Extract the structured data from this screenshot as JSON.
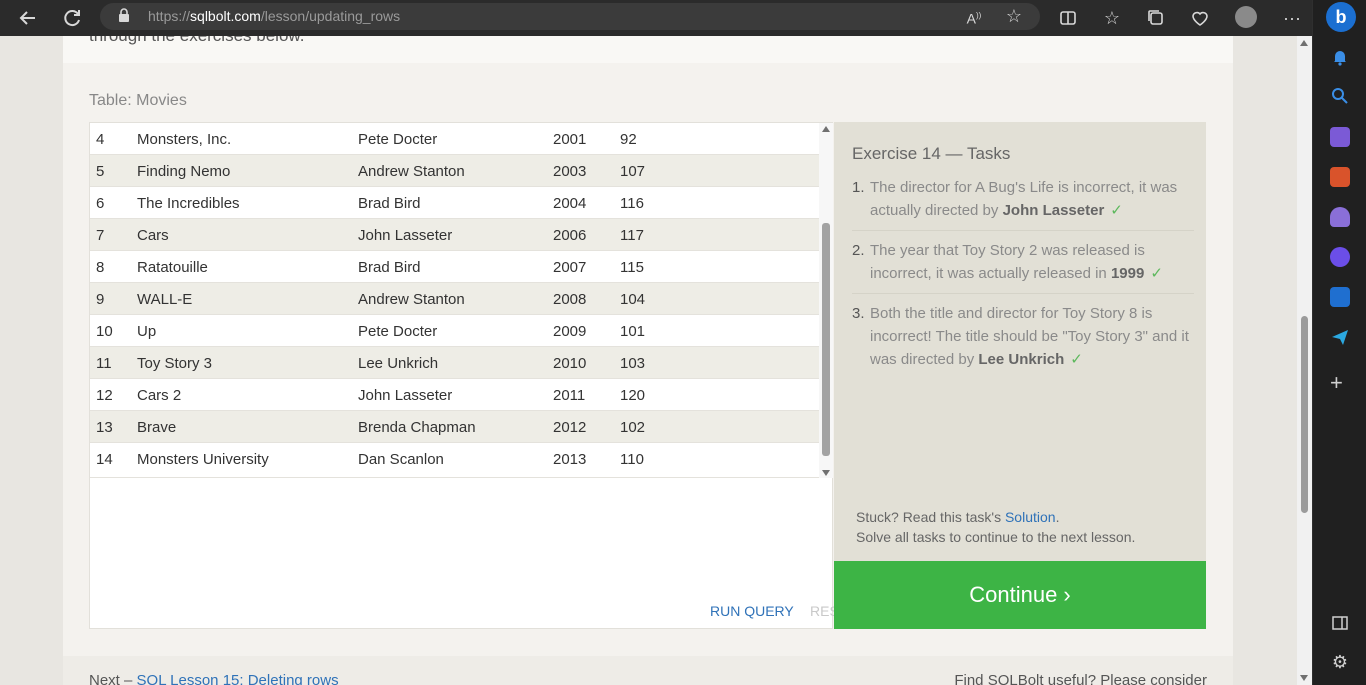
{
  "browser": {
    "url_prefix": "https://",
    "url_domain": "sqlbolt.com",
    "url_path": "/lesson/updating_rows"
  },
  "icons": {
    "back": "back-arrow-icon",
    "refresh": "refresh-icon",
    "lock": "lock-icon",
    "read_aloud": "read-aloud-icon",
    "favorite": "star-icon",
    "split_screen": "split-screen-icon",
    "favorites": "favorites-icon",
    "collections": "collections-icon",
    "health": "browser-essentials-icon",
    "profile": "profile-icon",
    "more": "more-icon"
  },
  "intro_text": "through the exercises below.",
  "table_caption": "Table: Movies",
  "movies": [
    {
      "id": "4",
      "title": "Monsters, Inc.",
      "director": "Pete Docter",
      "year": "2001",
      "length": "92"
    },
    {
      "id": "5",
      "title": "Finding Nemo",
      "director": "Andrew Stanton",
      "year": "2003",
      "length": "107"
    },
    {
      "id": "6",
      "title": "The Incredibles",
      "director": "Brad Bird",
      "year": "2004",
      "length": "116"
    },
    {
      "id": "7",
      "title": "Cars",
      "director": "John Lasseter",
      "year": "2006",
      "length": "117"
    },
    {
      "id": "8",
      "title": "Ratatouille",
      "director": "Brad Bird",
      "year": "2007",
      "length": "115"
    },
    {
      "id": "9",
      "title": "WALL-E",
      "director": "Andrew Stanton",
      "year": "2008",
      "length": "104"
    },
    {
      "id": "10",
      "title": "Up",
      "director": "Pete Docter",
      "year": "2009",
      "length": "101"
    },
    {
      "id": "11",
      "title": "Toy Story 3",
      "director": "Lee Unkrich",
      "year": "2010",
      "length": "103"
    },
    {
      "id": "12",
      "title": "Cars 2",
      "director": "John Lasseter",
      "year": "2011",
      "length": "120"
    },
    {
      "id": "13",
      "title": "Brave",
      "director": "Brenda Chapman",
      "year": "2012",
      "length": "102"
    },
    {
      "id": "14",
      "title": "Monsters University",
      "director": "Dan Scanlon",
      "year": "2013",
      "length": "110"
    }
  ],
  "buttons": {
    "run_query": "RUN QUERY",
    "reset": "RESET",
    "continue": "Continue ›"
  },
  "tasks": {
    "title": "Exercise 14 — Tasks",
    "items": [
      {
        "num": "1.",
        "text": "The director for A Bug's Life is incorrect, it was actually directed by ",
        "bold": "John Lasseter",
        "after": "",
        "check": "✓"
      },
      {
        "num": "2.",
        "text": "The year that Toy Story 2 was released is incorrect, it was actually released in ",
        "bold": "1999",
        "after": "",
        "check": "✓"
      },
      {
        "num": "3.",
        "text": "Both the title and director for Toy Story 8 is incorrect! The title should be \"Toy Story 3\" and it was directed by ",
        "bold": "Lee Unkrich",
        "after": "",
        "check": "✓"
      }
    ],
    "hint_prefix": "Stuck? Read this task's ",
    "hint_link": "Solution",
    "hint_suffix": ".",
    "hint_line2": "Solve all tasks to continue to the next lesson."
  },
  "footer": {
    "next_prefix": "Next – ",
    "next_link": "SQL Lesson 15: Deleting rows",
    "right_text": "Find SQLBolt useful? Please consider"
  }
}
